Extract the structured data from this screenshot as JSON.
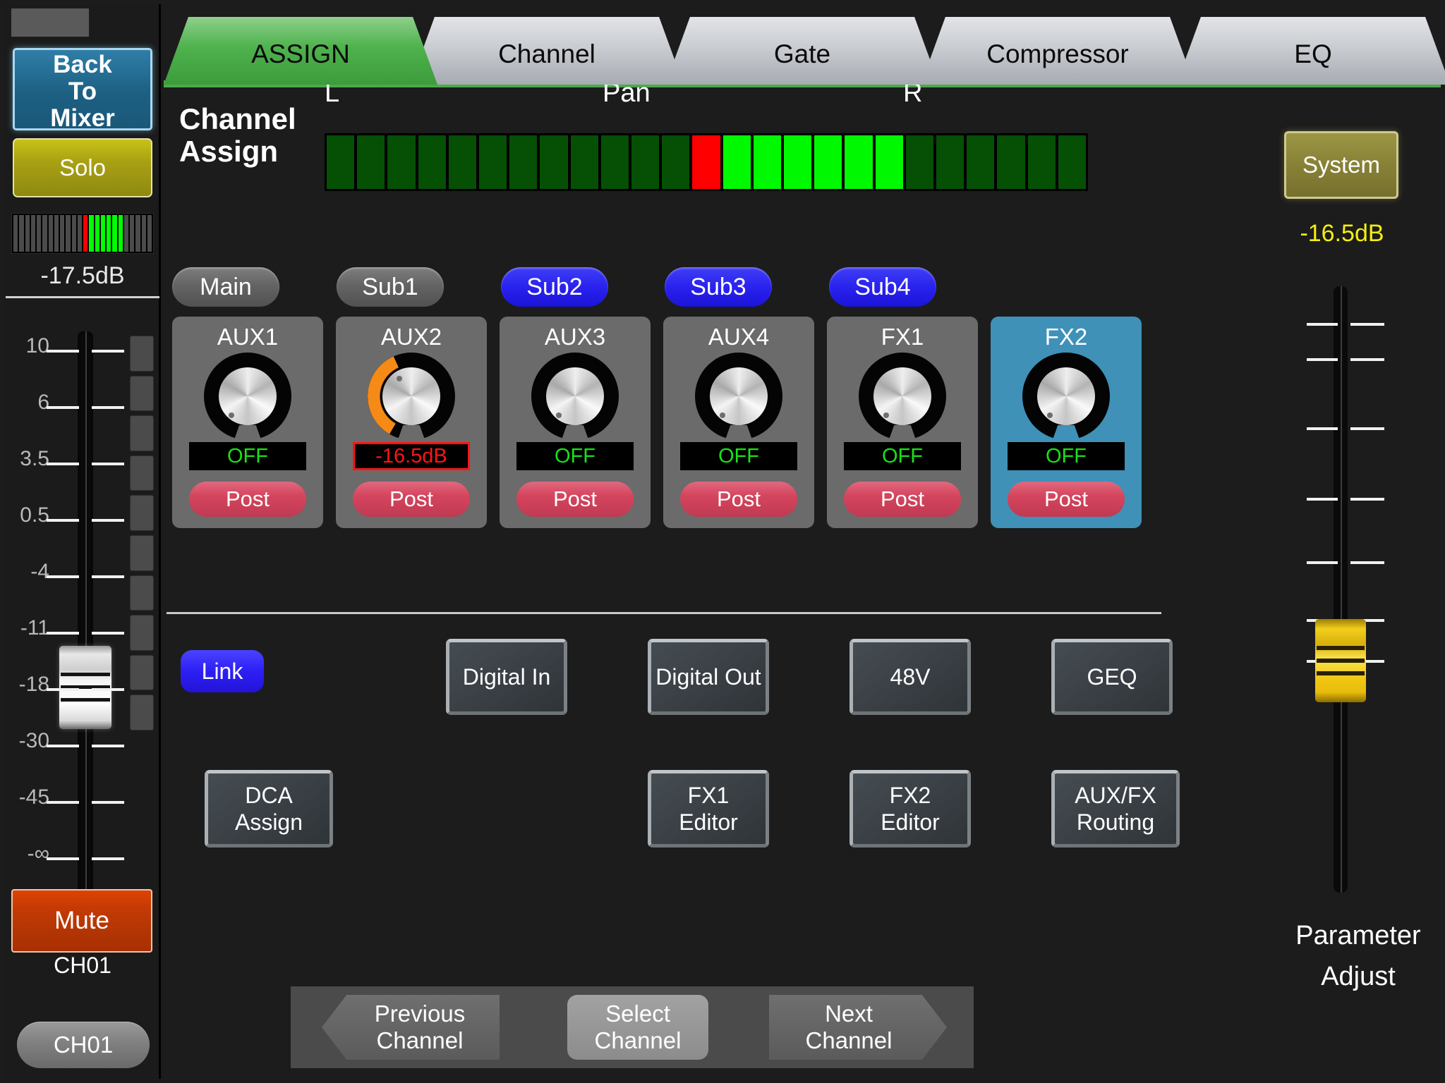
{
  "channel_strip": {
    "back_to_mixer_label": "Back\nTo\nMixer",
    "back_line1": "Back",
    "back_line2": "To",
    "back_line3": "Mixer",
    "solo_label": "Solo",
    "level_db": "-17.5dB",
    "mute_label": "Mute",
    "channel_caption": "CH01",
    "channel_select_label": "CH01",
    "fader_scale": [
      "10",
      "6",
      "3.5",
      "0.5",
      "-4",
      "-11",
      "-18",
      "-30",
      "-45",
      "-∞"
    ],
    "meter": {
      "segments": 24,
      "lit_red_index": 12,
      "lit_green_from": 13,
      "lit_green_to": 18,
      "color_off": "#4b4b4b",
      "color_red": "#ff0000",
      "color_green": "#00ff00"
    },
    "fader_position_label": "-18"
  },
  "tabs": [
    {
      "label": "ASSIGN",
      "active": true
    },
    {
      "label": "Channel",
      "active": false
    },
    {
      "label": "Gate",
      "active": false
    },
    {
      "label": "Compressor",
      "active": false
    },
    {
      "label": "EQ",
      "active": false
    }
  ],
  "assign": {
    "title_line1": "Channel",
    "title_line2": "Assign",
    "pan": {
      "label_left": "L",
      "label_center": "Pan",
      "label_right": "R",
      "segments": 25,
      "red_index": 12,
      "bright_from": 13,
      "bright_to": 18,
      "color_dim": "#055005",
      "color_bright": "#00f900",
      "color_red": "#ff0000"
    }
  },
  "buses": [
    {
      "label": "Main",
      "active": false
    },
    {
      "label": "Sub1",
      "active": false
    },
    {
      "label": "Sub2",
      "active": true
    },
    {
      "label": "Sub3",
      "active": true
    },
    {
      "label": "Sub4",
      "active": true
    }
  ],
  "sends": [
    {
      "name": "AUX1",
      "value": "OFF",
      "value_warn": false,
      "send_mode": "Post",
      "selected": false,
      "arc_pct": 0
    },
    {
      "name": "AUX2",
      "value": "-16.5dB",
      "value_warn": true,
      "send_mode": "Post",
      "selected": false,
      "arc_pct": 42
    },
    {
      "name": "AUX3",
      "value": "OFF",
      "value_warn": false,
      "send_mode": "Post",
      "selected": false,
      "arc_pct": 0
    },
    {
      "name": "AUX4",
      "value": "OFF",
      "value_warn": false,
      "send_mode": "Post",
      "selected": false,
      "arc_pct": 0
    },
    {
      "name": "FX1",
      "value": "OFF",
      "value_warn": false,
      "send_mode": "Post",
      "selected": false,
      "arc_pct": 0
    },
    {
      "name": "FX2",
      "value": "OFF",
      "value_warn": false,
      "send_mode": "Post",
      "selected": true,
      "arc_pct": 0
    }
  ],
  "actions": {
    "link_label": "Link",
    "row1": [
      {
        "label": "Digital In"
      },
      {
        "label": "Digital Out"
      },
      {
        "label": "48V"
      },
      {
        "label": "GEQ"
      }
    ],
    "dca_line1": "DCA",
    "dca_line2": "Assign",
    "row2": [
      {
        "line1": "FX1",
        "line2": "Editor"
      },
      {
        "line1": "FX2",
        "line2": "Editor"
      },
      {
        "line1": "AUX/FX",
        "line2": "Routing"
      }
    ]
  },
  "nav": {
    "previous_line1": "Previous",
    "previous_line2": "Channel",
    "select_line1": "Select",
    "select_line2": "Channel",
    "next_line1": "Next",
    "next_line2": "Channel"
  },
  "right_panel": {
    "system_label": "System",
    "system_db": "-16.5dB",
    "parameter_label_line1": "Parameter",
    "parameter_label_line2": "Adjust"
  },
  "colors": {
    "accent_green": "#4ca84b",
    "accent_blue": "#2d1ff5",
    "accent_red": "#d4455e",
    "selected_panel": "#3f91b8",
    "mute_orange": "#c33a04",
    "solo_yellow": "#a8a013",
    "system_olive": "#878137",
    "fader_yellow": "#f0c713"
  }
}
